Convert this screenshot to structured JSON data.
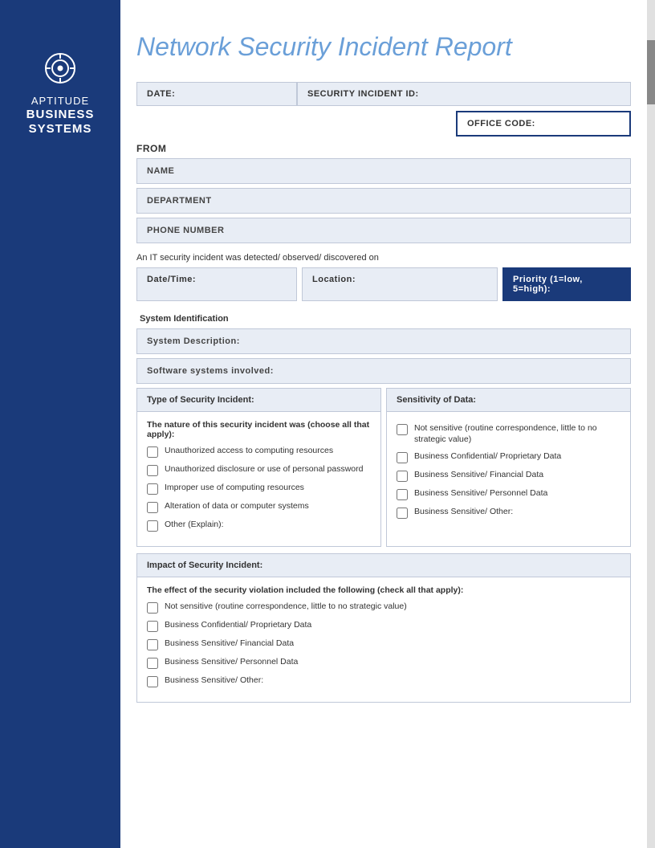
{
  "sidebar": {
    "brand_aptitude": "APTITUDE",
    "brand_business": "BUSINESS",
    "brand_systems": "SYSTEMS"
  },
  "header": {
    "title": "Network Security Incident Report"
  },
  "form": {
    "date_label": "DATE:",
    "security_id_label": "SECURITY INCIDENT ID:",
    "office_code_label": "OFFICE CODE:",
    "from_label": "FROM",
    "name_label": "NAME",
    "department_label": "DEPARTMENT",
    "phone_label": "PHONE NUMBER",
    "incident_text": "An IT security incident was detected/ observed/ discovered on",
    "datetime_label": "Date/Time:",
    "location_label": "Location:",
    "priority_label": "Priority (1=low, 5=high):",
    "system_identification_label": "System Identification",
    "system_description_label": "System Description:",
    "software_systems_label": "Software systems involved:"
  },
  "security_incident": {
    "panel_title": "Type of Security Incident:",
    "nature_text": "The nature of this security incident was (choose all that apply):",
    "checkboxes": [
      {
        "id": "si1",
        "label": "Unauthorized access to computing resources"
      },
      {
        "id": "si2",
        "label": "Unauthorized disclosure or use of personal password"
      },
      {
        "id": "si3",
        "label": "Improper use of computing resources"
      },
      {
        "id": "si4",
        "label": "Alteration of data or computer systems"
      },
      {
        "id": "si5",
        "label": "Other (Explain):"
      }
    ]
  },
  "sensitivity": {
    "panel_title": "Sensitivity of Data:",
    "checkboxes": [
      {
        "id": "sd1",
        "label": "Not sensitive (routine correspondence, little to no strategic value)"
      },
      {
        "id": "sd2",
        "label": "Business Confidential/ Proprietary Data"
      },
      {
        "id": "sd3",
        "label": "Business Sensitive/ Financial Data"
      },
      {
        "id": "sd4",
        "label": "Business Sensitive/ Personnel Data"
      },
      {
        "id": "sd5",
        "label": "Business Sensitive/ Other:"
      }
    ]
  },
  "impact": {
    "panel_title": "Impact of Security Incident:",
    "effect_text": "The effect of the security violation included the following (check all that apply):",
    "checkboxes": [
      {
        "id": "imp1",
        "label": "Not sensitive (routine correspondence, little to no strategic value)"
      },
      {
        "id": "imp2",
        "label": "Business Confidential/ Proprietary Data"
      },
      {
        "id": "imp3",
        "label": "Business Sensitive/ Financial Data"
      },
      {
        "id": "imp4",
        "label": "Business Sensitive/ Personnel Data"
      },
      {
        "id": "imp5",
        "label": "Business Sensitive/ Other:"
      }
    ]
  }
}
